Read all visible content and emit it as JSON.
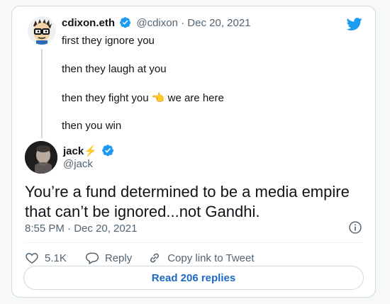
{
  "parent_tweet": {
    "name": "cdixon.eth",
    "handle": "@cdixon",
    "separator": "·",
    "date": "Dec 20, 2021",
    "lines": [
      "first they ignore you",
      "then they laugh at you",
      "then they fight you",
      "then you win"
    ],
    "pointing_text": "we are here",
    "pointing_emoji": "👈"
  },
  "reply_tweet": {
    "name": "jack",
    "name_emoji": "⚡",
    "handle": "@jack",
    "text": "You’re a fund determined to be a media empire that can’t be ignored...not Gandhi.",
    "timestamp": "8:55 PM · Dec 20, 2021"
  },
  "actions": {
    "likes": "5.1K",
    "reply_label": "Reply",
    "copy_label": "Copy link to Tweet"
  },
  "read_replies": "Read 206 replies",
  "colors": {
    "brand_blue": "#1d9bf0",
    "verified_blue": "#1d9bf0",
    "text": "#0f1419",
    "muted": "#536471",
    "border": "#cfd9de"
  },
  "icons": [
    "twitter-bird-icon",
    "verified-badge-icon",
    "heart-icon",
    "reply-bubble-icon",
    "link-icon",
    "info-icon"
  ]
}
